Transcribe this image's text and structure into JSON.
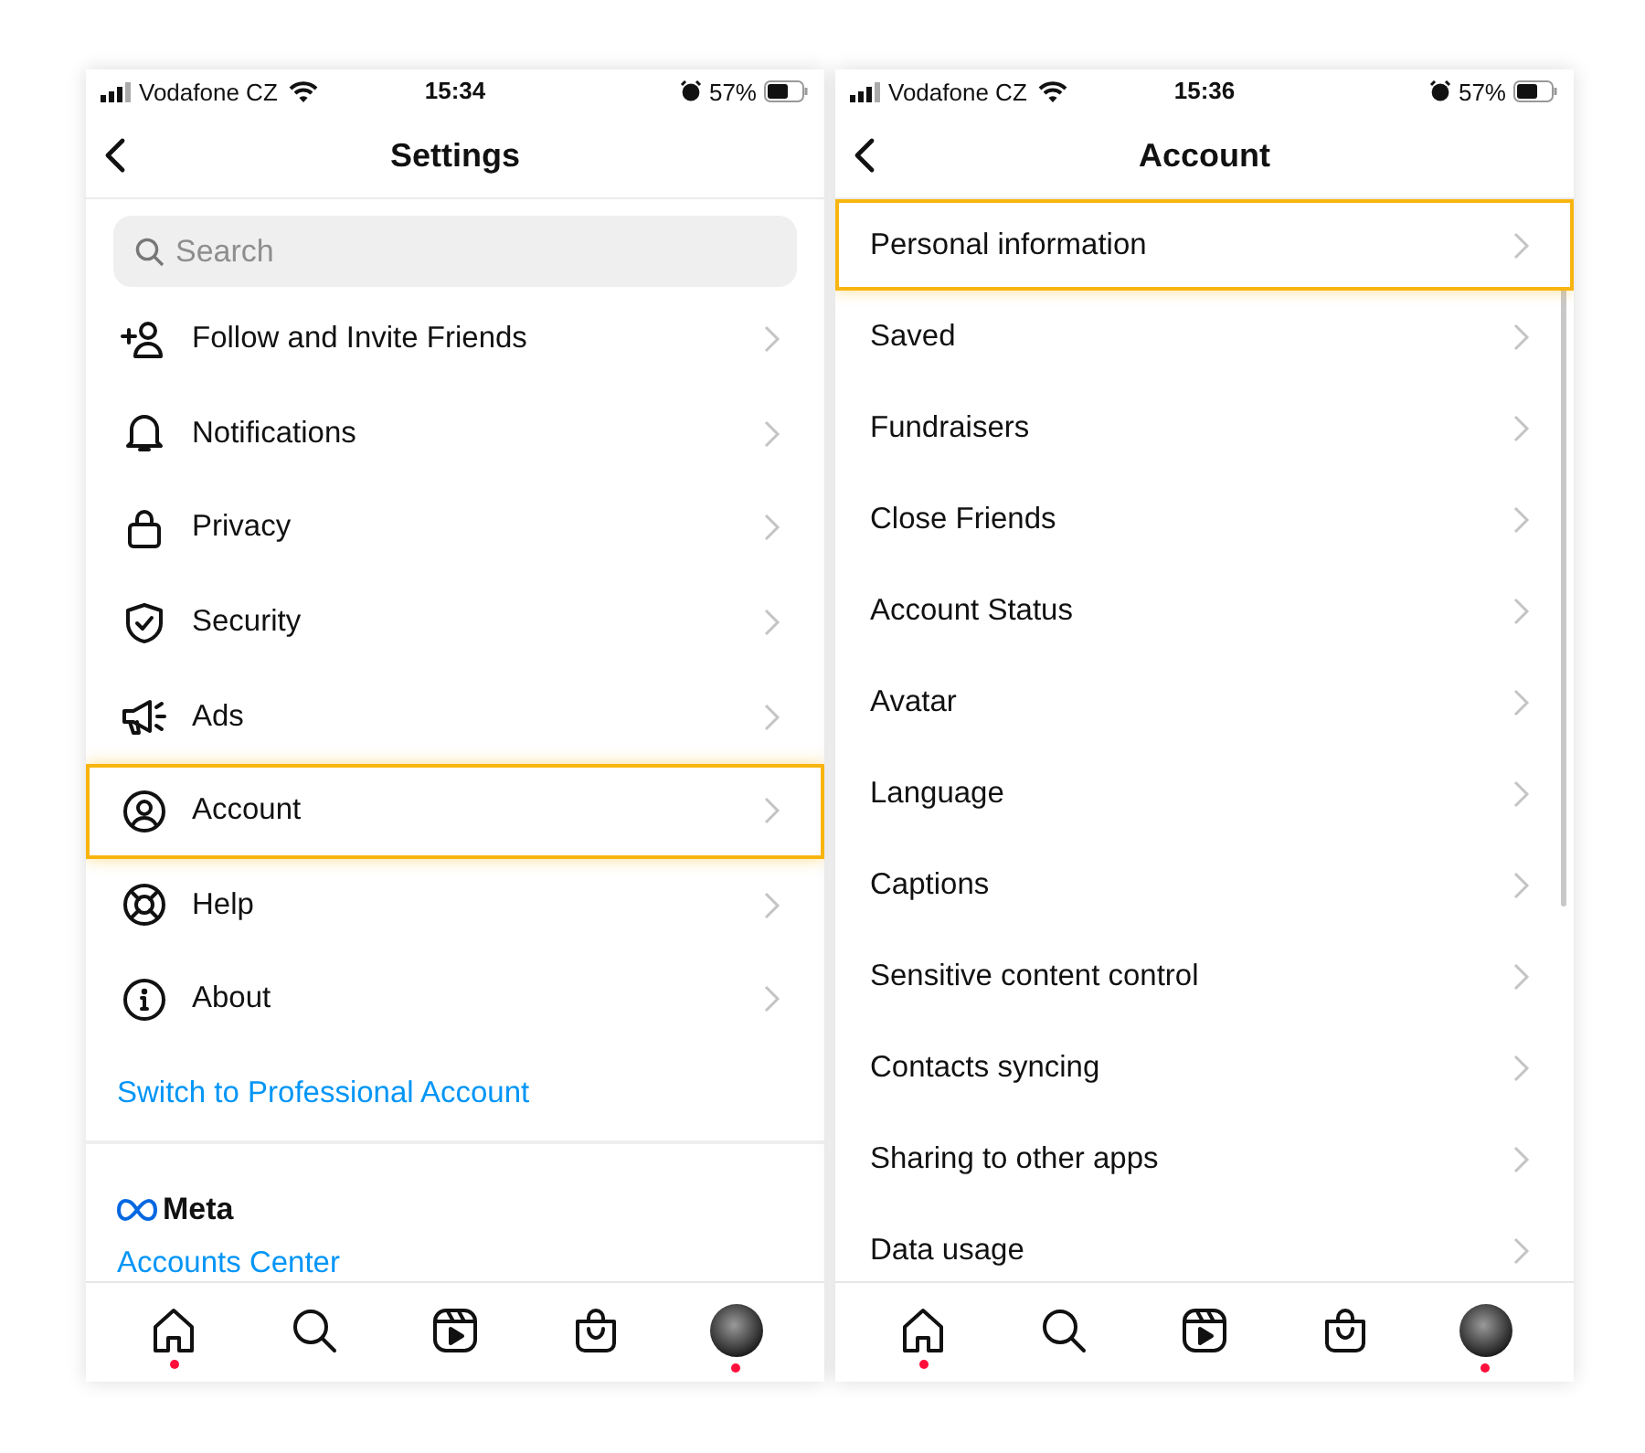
{
  "screens": [
    {
      "kind": "icon-list",
      "status_bar": {
        "carrier": "Vodafone CZ",
        "time": "15:34",
        "battery": "57%"
      },
      "header": {
        "title": "Settings"
      },
      "search": {
        "placeholder": "Search"
      },
      "items": [
        {
          "label": "Follow and Invite Friends",
          "highlighted": false
        },
        {
          "label": "Notifications",
          "highlighted": false
        },
        {
          "label": "Privacy",
          "highlighted": false
        },
        {
          "label": "Security",
          "highlighted": false
        },
        {
          "label": "Ads",
          "highlighted": false
        },
        {
          "label": "Account",
          "highlighted": true
        },
        {
          "label": "Help",
          "highlighted": false
        },
        {
          "label": "About",
          "highlighted": false
        }
      ],
      "professional_link": "Switch to Professional Account",
      "meta": {
        "brand": "Meta",
        "link": "Accounts Center"
      },
      "nav": [
        {
          "kind": "home",
          "dot": true
        },
        {
          "kind": "search",
          "dot": false
        },
        {
          "kind": "reels",
          "dot": false
        },
        {
          "kind": "shop",
          "dot": false
        },
        {
          "kind": "profile",
          "dot": true
        }
      ]
    },
    {
      "kind": "plain-list",
      "status_bar": {
        "carrier": "Vodafone CZ",
        "time": "15:36",
        "battery": "57%"
      },
      "header": {
        "title": "Account"
      },
      "items": [
        {
          "label": "Personal information",
          "highlighted": true
        },
        {
          "label": "Saved",
          "highlighted": false
        },
        {
          "label": "Fundraisers",
          "highlighted": false
        },
        {
          "label": "Close Friends",
          "highlighted": false
        },
        {
          "label": "Account Status",
          "highlighted": false
        },
        {
          "label": "Avatar",
          "highlighted": false
        },
        {
          "label": "Language",
          "highlighted": false
        },
        {
          "label": "Captions",
          "highlighted": false
        },
        {
          "label": "Sensitive content control",
          "highlighted": false
        },
        {
          "label": "Contacts syncing",
          "highlighted": false
        },
        {
          "label": "Sharing to other apps",
          "highlighted": false
        },
        {
          "label": "Data usage",
          "highlighted": false
        }
      ],
      "nav": [
        {
          "kind": "home",
          "dot": true
        },
        {
          "kind": "search",
          "dot": false
        },
        {
          "kind": "reels",
          "dot": false
        },
        {
          "kind": "shop",
          "dot": false
        },
        {
          "kind": "profile",
          "dot": true
        }
      ]
    }
  ]
}
